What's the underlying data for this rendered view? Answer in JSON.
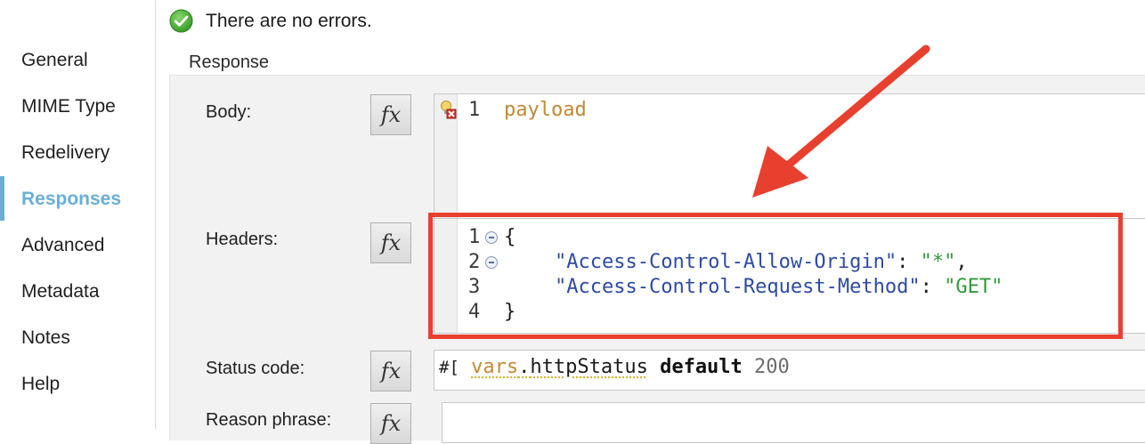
{
  "sidebar": {
    "items": [
      {
        "label": "General",
        "active": false
      },
      {
        "label": "MIME Type",
        "active": false
      },
      {
        "label": "Redelivery",
        "active": false
      },
      {
        "label": "Responses",
        "active": true
      },
      {
        "label": "Advanced",
        "active": false
      },
      {
        "label": "Metadata",
        "active": false
      },
      {
        "label": "Notes",
        "active": false
      },
      {
        "label": "Help",
        "active": false
      }
    ]
  },
  "status": {
    "text": "There are no errors.",
    "icon": "check-circle-icon"
  },
  "section": {
    "title": "Response"
  },
  "fields": {
    "body": {
      "label": "Body:",
      "fx": "fx",
      "line_number": "1",
      "code": "payload"
    },
    "headers": {
      "label": "Headers:",
      "fx": "fx",
      "lines": [
        {
          "num": "1",
          "open": "{"
        },
        {
          "num": "2",
          "key": "\"Access-Control-Allow-Origin\"",
          "sep": ": ",
          "value": "\"*\"",
          "trail": ","
        },
        {
          "num": "3",
          "key": "\"Access-Control-Request-Method\"",
          "sep": ": ",
          "value": "\"GET\"",
          "trail": ""
        },
        {
          "num": "4",
          "close": "}"
        }
      ]
    },
    "status_code": {
      "label": "Status code:",
      "fx": "fx",
      "prefix": "#[",
      "var": "vars",
      "dot": ".",
      "prop": "httpStatus",
      "keyword": "default",
      "number": "200"
    },
    "reason_phrase": {
      "label": "Reason phrase:",
      "fx": "fx",
      "value": ""
    }
  },
  "colors": {
    "accent": "#6aaed6",
    "highlight": "#e8402e",
    "success": "#3aa52a"
  }
}
